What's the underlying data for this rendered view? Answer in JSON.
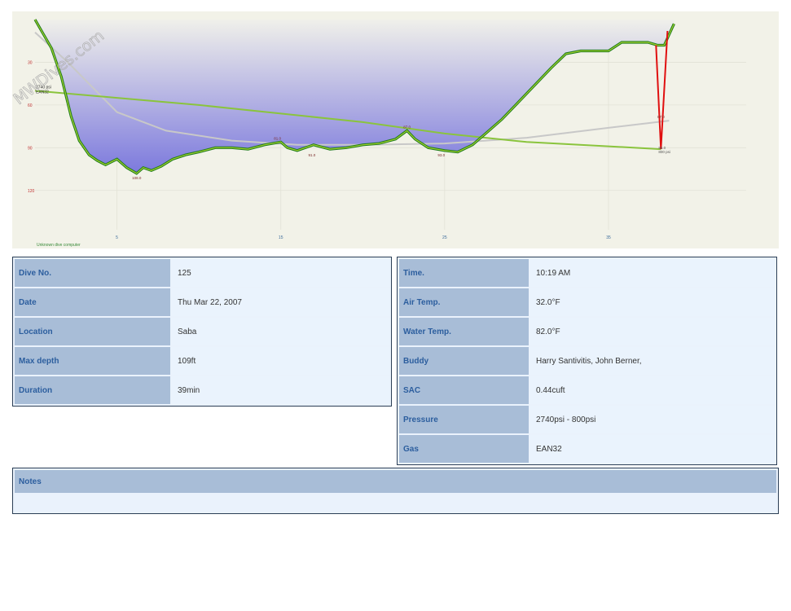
{
  "watermark": "MWDives.com",
  "chart_data": {
    "type": "line",
    "x_unit": "min",
    "y_unit": "ft",
    "xlim": [
      0,
      44
    ],
    "ylim": [
      0,
      135
    ],
    "x_ticks": [
      {
        "value": 5,
        "label": "5"
      },
      {
        "value": 15,
        "label": "15"
      },
      {
        "value": 25,
        "label": "25"
      },
      {
        "value": 35,
        "label": "35"
      }
    ],
    "y_ticks": [
      {
        "value": 30,
        "label": "30"
      },
      {
        "value": 60,
        "label": "60"
      },
      {
        "value": 90,
        "label": "90"
      },
      {
        "value": 120,
        "label": "120"
      }
    ],
    "depth_profile": [
      [
        0,
        0
      ],
      [
        0.4,
        8
      ],
      [
        1.0,
        20
      ],
      [
        1.6,
        40
      ],
      [
        2.2,
        68
      ],
      [
        2.7,
        85
      ],
      [
        3.3,
        95
      ],
      [
        3.8,
        99
      ],
      [
        4.3,
        102
      ],
      [
        5.0,
        98
      ],
      [
        5.6,
        104
      ],
      [
        6.2,
        108
      ],
      [
        6.6,
        104
      ],
      [
        7.1,
        106
      ],
      [
        7.7,
        103
      ],
      [
        8.4,
        98
      ],
      [
        9.2,
        95
      ],
      [
        10.0,
        93
      ],
      [
        11.0,
        90
      ],
      [
        12.0,
        90
      ],
      [
        13.0,
        91
      ],
      [
        14.0,
        88
      ],
      [
        15.0,
        86
      ],
      [
        15.4,
        90
      ],
      [
        16.0,
        92
      ],
      [
        17.0,
        88
      ],
      [
        18.0,
        91
      ],
      [
        19.0,
        90
      ],
      [
        20.0,
        88
      ],
      [
        21.0,
        87
      ],
      [
        22.0,
        84
      ],
      [
        22.7,
        78
      ],
      [
        23.2,
        84
      ],
      [
        24.0,
        90
      ],
      [
        25.0,
        92
      ],
      [
        25.8,
        93
      ],
      [
        26.7,
        88
      ],
      [
        27.5,
        80
      ],
      [
        28.5,
        70
      ],
      [
        29.5,
        58
      ],
      [
        30.5,
        46
      ],
      [
        31.5,
        34
      ],
      [
        32.4,
        24
      ],
      [
        33.3,
        22
      ],
      [
        34.2,
        22
      ],
      [
        35.0,
        22
      ],
      [
        35.8,
        16
      ],
      [
        36.7,
        16
      ],
      [
        37.4,
        16
      ],
      [
        38.0,
        18
      ],
      [
        38.4,
        18
      ],
      [
        39.0,
        3
      ]
    ],
    "ascent_segment": [
      [
        37.9,
        18
      ],
      [
        38.2,
        91
      ],
      [
        38.6,
        8
      ]
    ],
    "temperature_line": [
      [
        0,
        9
      ],
      [
        2,
        30
      ],
      [
        5,
        65
      ],
      [
        8,
        78
      ],
      [
        12,
        85
      ],
      [
        16,
        88
      ],
      [
        20,
        88
      ],
      [
        25,
        87
      ],
      [
        30,
        83
      ],
      [
        35,
        76
      ],
      [
        38.7,
        71
      ]
    ],
    "pressure_line": [
      [
        0,
        50
      ],
      [
        5,
        55
      ],
      [
        10,
        60
      ],
      [
        15,
        66
      ],
      [
        20,
        72
      ],
      [
        25,
        80
      ],
      [
        30,
        86
      ],
      [
        35,
        89
      ],
      [
        38.2,
        91
      ]
    ],
    "annotations": [
      {
        "x": 6.2,
        "y": 108,
        "label": "108.0"
      },
      {
        "x": 14.8,
        "y": 86,
        "label": "81.0"
      },
      {
        "x": 16.9,
        "y": 92,
        "label": "91.0"
      },
      {
        "x": 22.7,
        "y": 78,
        "label": "87.0"
      },
      {
        "x": 24.8,
        "y": 92,
        "label": "93.0"
      },
      {
        "x": 38.2,
        "y": 71,
        "label": "87.0"
      }
    ],
    "start_labels": [
      "2740 psi",
      "EAN32"
    ],
    "end_labels": [
      "85.0",
      "800 psi"
    ],
    "computer_label": "Unknown dive computer"
  },
  "dive": {
    "rows": [
      {
        "label": "Dive No.",
        "value": "125"
      },
      {
        "label": "Date",
        "value": "Thu Mar 22, 2007"
      },
      {
        "label": "Location",
        "value": "Saba"
      },
      {
        "label": "Max depth",
        "value": "109ft"
      },
      {
        "label": "Duration",
        "value": "39min"
      }
    ]
  },
  "conditions": {
    "rows": [
      {
        "label": "Time.",
        "value": "10:19 AM"
      },
      {
        "label": "Air Temp.",
        "value": "32.0°F"
      },
      {
        "label": "Water Temp.",
        "value": "82.0°F"
      },
      {
        "label": "Buddy",
        "value": "Harry Santivitis, John Berner,"
      },
      {
        "label": "SAC",
        "value": "0.44cuft"
      },
      {
        "label": "Pressure",
        "value": "2740psi - 800psi"
      },
      {
        "label": "Gas",
        "value": "EAN32"
      }
    ]
  },
  "notes": {
    "label": "Notes",
    "text": ""
  },
  "colors": {
    "depth_line": "#1b7a1b",
    "depth_line_light": "#a4d02e",
    "fill_top": "#f0f0ea",
    "fill_bottom": "#7c79dd",
    "pressure": "#8ac43d",
    "temperature": "#c8c8c8",
    "ascent": "#e01010",
    "label_bg": "#a8bdd7",
    "label_text": "#2c5e9e"
  }
}
